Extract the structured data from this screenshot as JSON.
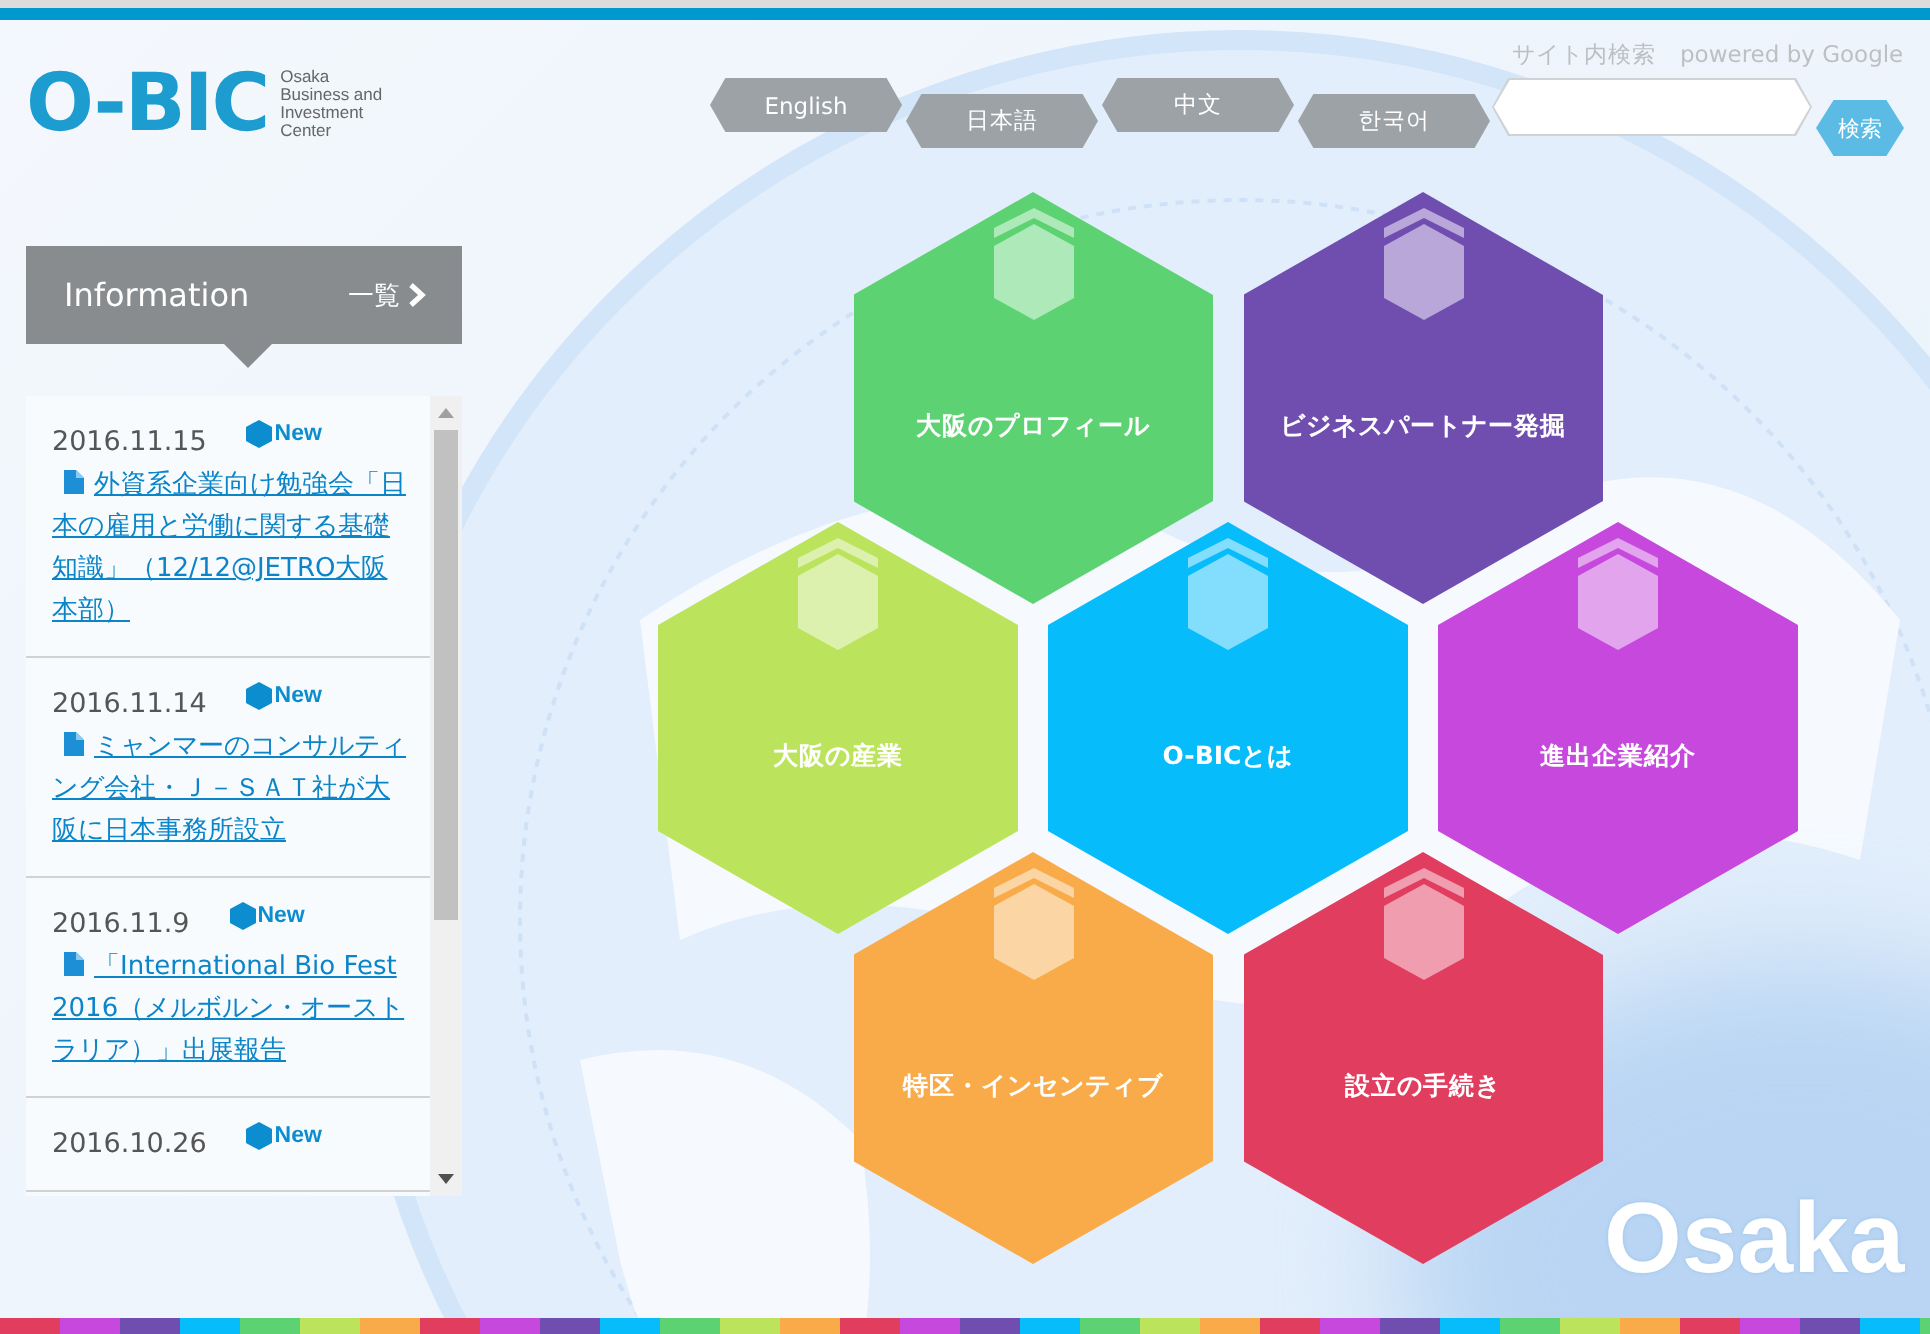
{
  "logo": {
    "mark": "O-BIC",
    "tagline": [
      "Osaka",
      "Business and",
      "Investment",
      "Center"
    ]
  },
  "languages": [
    {
      "label": "English"
    },
    {
      "label": "日本語"
    },
    {
      "label": "中文"
    },
    {
      "label": "한국어"
    }
  ],
  "search": {
    "label": "サイト内検索",
    "powered_by": "powered by Google",
    "button": "検索"
  },
  "information": {
    "title": "Information",
    "more": "一覧",
    "items": [
      {
        "date": "2016.11.15",
        "badge": "New",
        "title": "外資系企業向け勉強会「日本の雇用と労働に関する基礎知識」（12/12@JETRO大阪本部）"
      },
      {
        "date": "2016.11.14",
        "badge": "New",
        "title": "ミャンマーのコンサルティング会社・Ｊ－ＳＡＴ社が大阪に日本事務所設立"
      },
      {
        "date": "2016.11.9",
        "badge": "New",
        "title": "「International Bio Fest 2016（メルボルン・オーストラリア）」出展報告"
      },
      {
        "date": "2016.10.26",
        "badge": "New"
      }
    ]
  },
  "tiles": [
    [
      {
        "label": "大阪のプロフィール",
        "color": "#5dd272"
      },
      {
        "label": "ビジネスパートナー発掘",
        "color": "#704eb0"
      }
    ],
    [
      {
        "label": "大阪の産業",
        "color": "#bbe35c"
      },
      {
        "label": "O-BICとは",
        "color": "#07bcfb"
      },
      {
        "label": "進出企業紹介",
        "color": "#c648dd"
      }
    ],
    [
      {
        "label": "特区・インセンティブ",
        "color": "#f8ab48"
      },
      {
        "label": "設立の手続き",
        "color": "#e03d5f"
      }
    ]
  ],
  "background_text": "Osaka"
}
